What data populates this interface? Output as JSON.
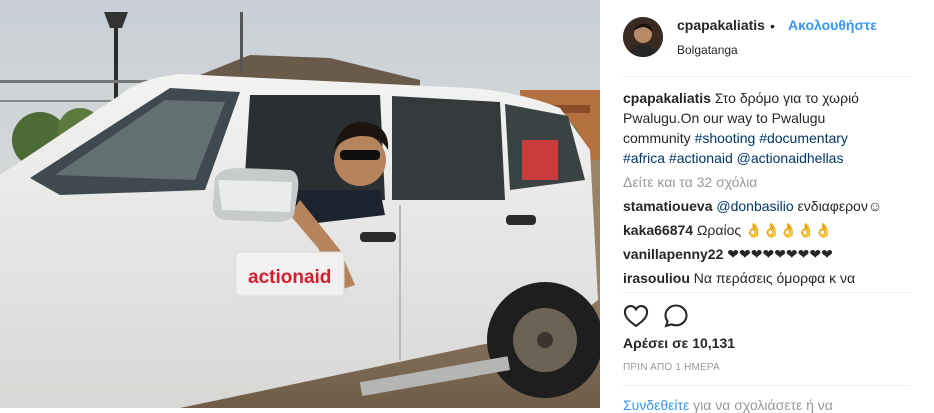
{
  "post": {
    "username": "cpapakaliatis",
    "separator": "•",
    "follow_label": "Ακολουθήστε",
    "location": "Bolgatanga",
    "decal_text": "actionaid"
  },
  "caption": {
    "username": "cpapakaliatis",
    "text_1": " Στο δρόμο για το χωριό Pwalugu.On our way to Pwalugu community ",
    "tags": [
      "#shooting",
      "#documentary",
      "#africa",
      "#actionaid",
      "@actionaidhellas"
    ]
  },
  "view_all": "Δείτε και τα 32 σχόλια",
  "comments": [
    {
      "user": "stamatioueva",
      "mention": "@donbasilio",
      "text": " ενδιαφερον☺"
    },
    {
      "user": "kaka66874",
      "mention": "",
      "text": " Ωραίος 👌👌👌👌👌"
    },
    {
      "user": "vanillapenny22",
      "mention": "",
      "text": " ❤❤❤❤❤❤❤❤❤"
    },
    {
      "user": "irasouliou",
      "mention": "",
      "text": " Να περάσεις όμορφα κ να"
    }
  ],
  "actions": {
    "like_icon": "heart-outline-icon",
    "comment_icon": "speech-bubble-icon"
  },
  "likes": "Αρέσει σε 10,131",
  "timestamp": "ΠΡΙΝ ΑΠΟ 1 ΗΜΕΡΑ",
  "login": {
    "link": "Συνδεθείτε",
    "text": " για να σχολιάσετε ή να"
  },
  "colors": {
    "accent": "#3897f0",
    "hashtag": "#003569",
    "muted": "#999999",
    "text": "#262626"
  }
}
